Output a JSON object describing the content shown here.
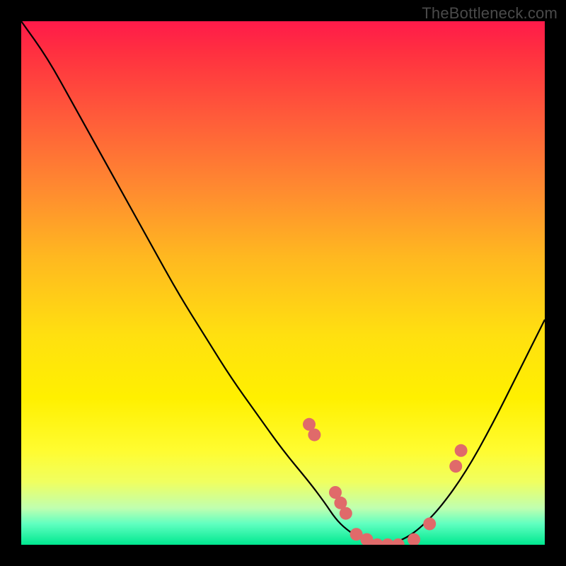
{
  "watermark": "TheBottleneck.com",
  "colors": {
    "frame": "#000000",
    "curve": "#000000",
    "dot": "#e06a6a",
    "gradient_top": "#ff1a4a",
    "gradient_bottom": "#00e890"
  },
  "chart_data": {
    "type": "line",
    "title": "",
    "xlabel": "",
    "ylabel": "",
    "xlim": [
      0,
      100
    ],
    "ylim": [
      0,
      100
    ],
    "curve": {
      "x": [
        0,
        5,
        10,
        15,
        20,
        25,
        30,
        35,
        40,
        45,
        50,
        55,
        58,
        60,
        62,
        65,
        68,
        70,
        73,
        76,
        80,
        85,
        90,
        95,
        100
      ],
      "y": [
        100,
        93,
        84,
        75,
        66,
        57,
        48,
        40,
        32,
        25,
        18,
        12,
        8,
        5,
        3,
        1,
        0,
        0,
        1,
        3,
        7,
        14,
        23,
        33,
        43
      ]
    },
    "dots": [
      {
        "x": 55,
        "y": 23
      },
      {
        "x": 56,
        "y": 21
      },
      {
        "x": 60,
        "y": 10
      },
      {
        "x": 61,
        "y": 8
      },
      {
        "x": 62,
        "y": 6
      },
      {
        "x": 64,
        "y": 2
      },
      {
        "x": 66,
        "y": 1
      },
      {
        "x": 68,
        "y": 0
      },
      {
        "x": 70,
        "y": 0
      },
      {
        "x": 72,
        "y": 0
      },
      {
        "x": 75,
        "y": 1
      },
      {
        "x": 78,
        "y": 4
      },
      {
        "x": 83,
        "y": 15
      },
      {
        "x": 84,
        "y": 18
      }
    ]
  }
}
